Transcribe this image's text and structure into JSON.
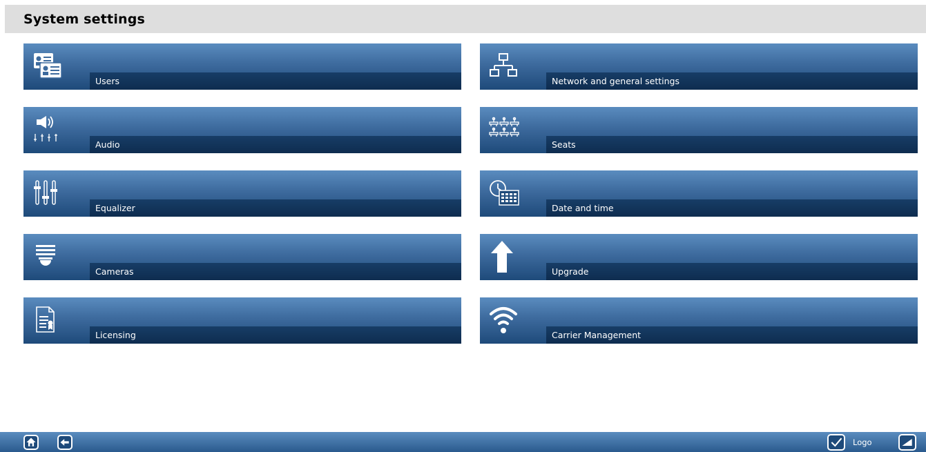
{
  "header": {
    "title": "System settings"
  },
  "tiles": [
    {
      "label": "Users",
      "icon": "users-icon"
    },
    {
      "label": "Network and general settings",
      "icon": "network-icon"
    },
    {
      "label": "Audio",
      "icon": "audio-icon"
    },
    {
      "label": "Seats",
      "icon": "seats-icon"
    },
    {
      "label": "Equalizer",
      "icon": "equalizer-icon"
    },
    {
      "label": "Date and time",
      "icon": "clock-calendar-icon"
    },
    {
      "label": "Cameras",
      "icon": "camera-icon"
    },
    {
      "label": "Upgrade",
      "icon": "upload-arrow-icon"
    },
    {
      "label": "Licensing",
      "icon": "license-icon"
    },
    {
      "label": "Carrier Management",
      "icon": "wifi-icon"
    }
  ],
  "footer": {
    "home_icon": "home-icon",
    "back_icon": "back-arrow-icon",
    "check_icon": "checkmark-icon",
    "logo_label": "Logo",
    "volume_icon": "volume-wedge-icon"
  },
  "colors": {
    "header_bg": "#dedede",
    "tile_top": "#5a8cbf",
    "tile_bottom": "#1e4a7a",
    "label_band": "#0e2c4f",
    "text": "#ffffff"
  }
}
